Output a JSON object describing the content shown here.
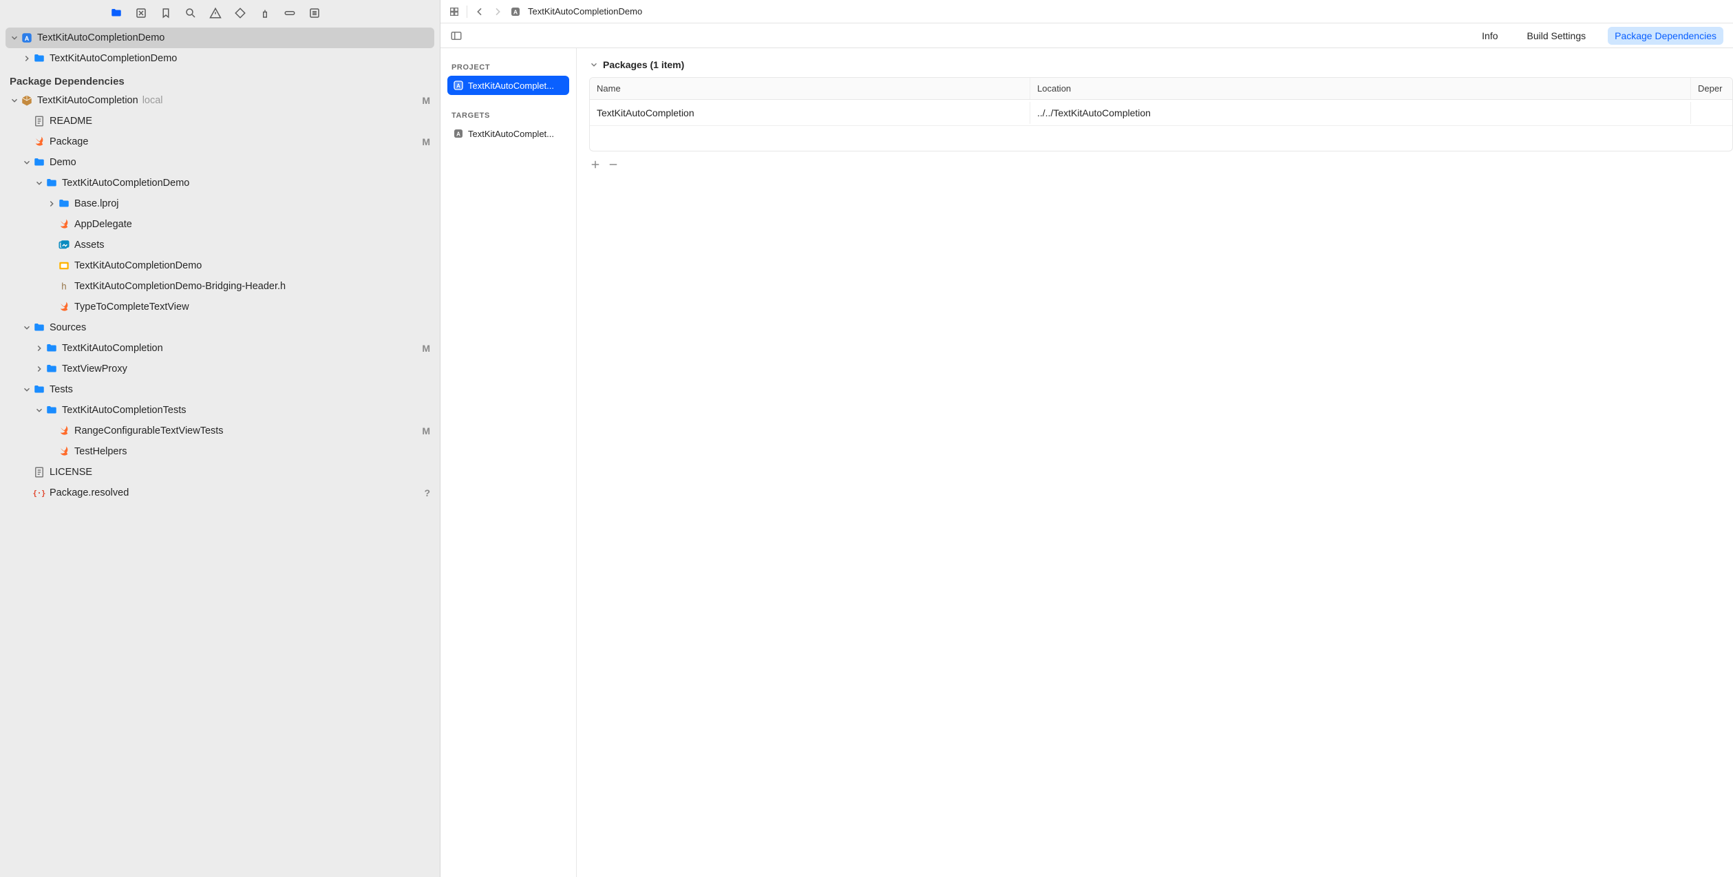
{
  "toolbar_icons": [
    "folder-icon",
    "stop-icon",
    "bookmark-icon",
    "search-icon",
    "warning-icon",
    "diamond-icon",
    "spray-icon",
    "pill-icon",
    "list-icon"
  ],
  "tree_section_header": "Package Dependencies",
  "tree": [
    {
      "id": "root",
      "indent": 0,
      "disclosure": "down",
      "icon": "app",
      "label": "TextKitAutoCompletionDemo",
      "selected": true
    },
    {
      "id": "rootsub",
      "indent": 1,
      "disclosure": "right",
      "icon": "folder",
      "label": "TextKitAutoCompletionDemo"
    },
    {
      "id": "pd_header",
      "section": true
    },
    {
      "id": "pkg",
      "indent": 0,
      "disclosure": "down",
      "icon": "package",
      "label": "TextKitAutoCompletion",
      "suffix": "local",
      "badge": "M"
    },
    {
      "id": "readme",
      "indent": 1,
      "disclosure": "none",
      "icon": "readme",
      "label": "README"
    },
    {
      "id": "package",
      "indent": 1,
      "disclosure": "none",
      "icon": "swift",
      "label": "Package",
      "badge": "M"
    },
    {
      "id": "demo",
      "indent": 1,
      "disclosure": "down",
      "icon": "folder",
      "label": "Demo"
    },
    {
      "id": "demoproj",
      "indent": 2,
      "disclosure": "down",
      "icon": "folder",
      "label": "TextKitAutoCompletionDemo"
    },
    {
      "id": "baselproj",
      "indent": 3,
      "disclosure": "right",
      "icon": "folder",
      "label": "Base.lproj"
    },
    {
      "id": "appdel",
      "indent": 3,
      "disclosure": "none",
      "icon": "swift",
      "label": "AppDelegate"
    },
    {
      "id": "assets",
      "indent": 3,
      "disclosure": "none",
      "icon": "assets",
      "label": "Assets"
    },
    {
      "id": "story",
      "indent": 3,
      "disclosure": "none",
      "icon": "storyboard",
      "label": "TextKitAutoCompletionDemo"
    },
    {
      "id": "bridge",
      "indent": 3,
      "disclosure": "none",
      "icon": "header",
      "label": "TextKitAutoCompletionDemo-Bridging-Header.h"
    },
    {
      "id": "typetc",
      "indent": 3,
      "disclosure": "none",
      "icon": "swift",
      "label": "TypeToCompleteTextView"
    },
    {
      "id": "sources",
      "indent": 1,
      "disclosure": "down",
      "icon": "folder",
      "label": "Sources"
    },
    {
      "id": "srctk",
      "indent": 2,
      "disclosure": "right",
      "icon": "folder",
      "label": "TextKitAutoCompletion",
      "badge": "M"
    },
    {
      "id": "srctvp",
      "indent": 2,
      "disclosure": "right",
      "icon": "folder",
      "label": "TextViewProxy"
    },
    {
      "id": "tests",
      "indent": 1,
      "disclosure": "down",
      "icon": "folder",
      "label": "Tests"
    },
    {
      "id": "testsfold",
      "indent": 2,
      "disclosure": "down",
      "icon": "folder",
      "label": "TextKitAutoCompletionTests"
    },
    {
      "id": "rctests",
      "indent": 3,
      "disclosure": "none",
      "icon": "swift",
      "label": "RangeConfigurableTextViewTests",
      "badge": "M"
    },
    {
      "id": "thelp",
      "indent": 3,
      "disclosure": "none",
      "icon": "swift",
      "label": "TestHelpers"
    },
    {
      "id": "license",
      "indent": 1,
      "disclosure": "none",
      "icon": "license",
      "label": "LICENSE"
    },
    {
      "id": "resolved",
      "indent": 1,
      "disclosure": "none",
      "icon": "resolved",
      "label": "Package.resolved",
      "badge": "?"
    }
  ],
  "jumpbar": {
    "title": "TextKitAutoCompletionDemo"
  },
  "tabs": {
    "info": "Info",
    "build": "Build Settings",
    "deps": "Package Dependencies"
  },
  "project_sidebar": {
    "project_label": "PROJECT",
    "project_item": "TextKitAutoComplet...",
    "targets_label": "TARGETS",
    "target_item": "TextKitAutoComplet..."
  },
  "packages": {
    "header": "Packages (1 item)",
    "columns": {
      "name": "Name",
      "location": "Location",
      "dep": "Deper"
    },
    "rows": [
      {
        "name": "TextKitAutoCompletion",
        "location": "../../TextKitAutoCompletion",
        "dep": ""
      }
    ]
  }
}
